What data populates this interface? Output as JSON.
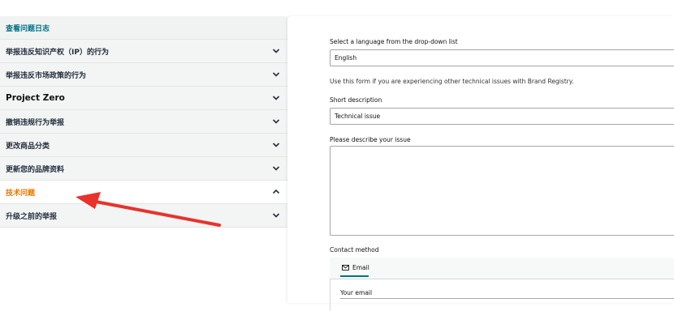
{
  "sidebar": {
    "items": [
      {
        "label": "查看问题日志"
      },
      {
        "label": "举报违反知识产权（IP）的行为"
      },
      {
        "label": "举报违反市场政策的行为"
      },
      {
        "label": "Project Zero"
      },
      {
        "label": "撤销违规行为举报"
      },
      {
        "label": "更改商品分类"
      },
      {
        "label": "更新您的品牌资料"
      },
      {
        "label": "技术问题"
      },
      {
        "label": "升级之前的举报"
      }
    ]
  },
  "form": {
    "language_label": "Select a language from the drop-down list",
    "language_value": "English",
    "info_text": "Use this form if you are experiencing other technical issues with Brand Registry.",
    "short_desc_label": "Short description",
    "short_desc_value": "Technical issue",
    "describe_label": "Please describe your issue",
    "describe_value": "",
    "contact_label": "Contact method",
    "contact_tab": "Email",
    "email_label": "Your email"
  },
  "colors": {
    "link_teal": "#007185",
    "active_orange": "#e77600",
    "annotation_red": "#e8322a"
  },
  "icons": {
    "collapsed": "chevron-down-icon",
    "expanded": "chevron-up-icon",
    "email_tab": "mail-icon"
  }
}
